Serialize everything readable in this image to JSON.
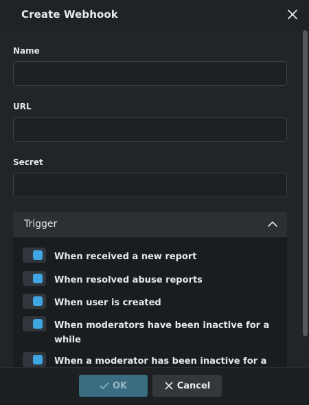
{
  "dialog": {
    "title": "Create Webhook"
  },
  "fields": {
    "name": {
      "label": "Name",
      "value": "",
      "placeholder": ""
    },
    "url": {
      "label": "URL",
      "value": "",
      "placeholder": ""
    },
    "secret": {
      "label": "Secret",
      "value": "",
      "placeholder": ""
    }
  },
  "trigger": {
    "title": "Trigger",
    "expanded": true,
    "items": [
      {
        "label": "When received a new report",
        "enabled": true
      },
      {
        "label": "When resolved abuse reports",
        "enabled": true
      },
      {
        "label": "When user is created",
        "enabled": true
      },
      {
        "label": "When moderators have been inactive for a while",
        "enabled": true
      },
      {
        "label": "When a moderator has been inactive for a",
        "enabled": true
      }
    ]
  },
  "footer": {
    "ok_label": "OK",
    "cancel_label": "Cancel"
  },
  "colors": {
    "accent": "#3ea6e0",
    "ok_button": "#3b6d82",
    "background": "#212529"
  },
  "icons": {
    "close": "close-icon",
    "chevron": "chevron-up-icon",
    "ok": "check-icon",
    "cancel": "x-icon"
  }
}
